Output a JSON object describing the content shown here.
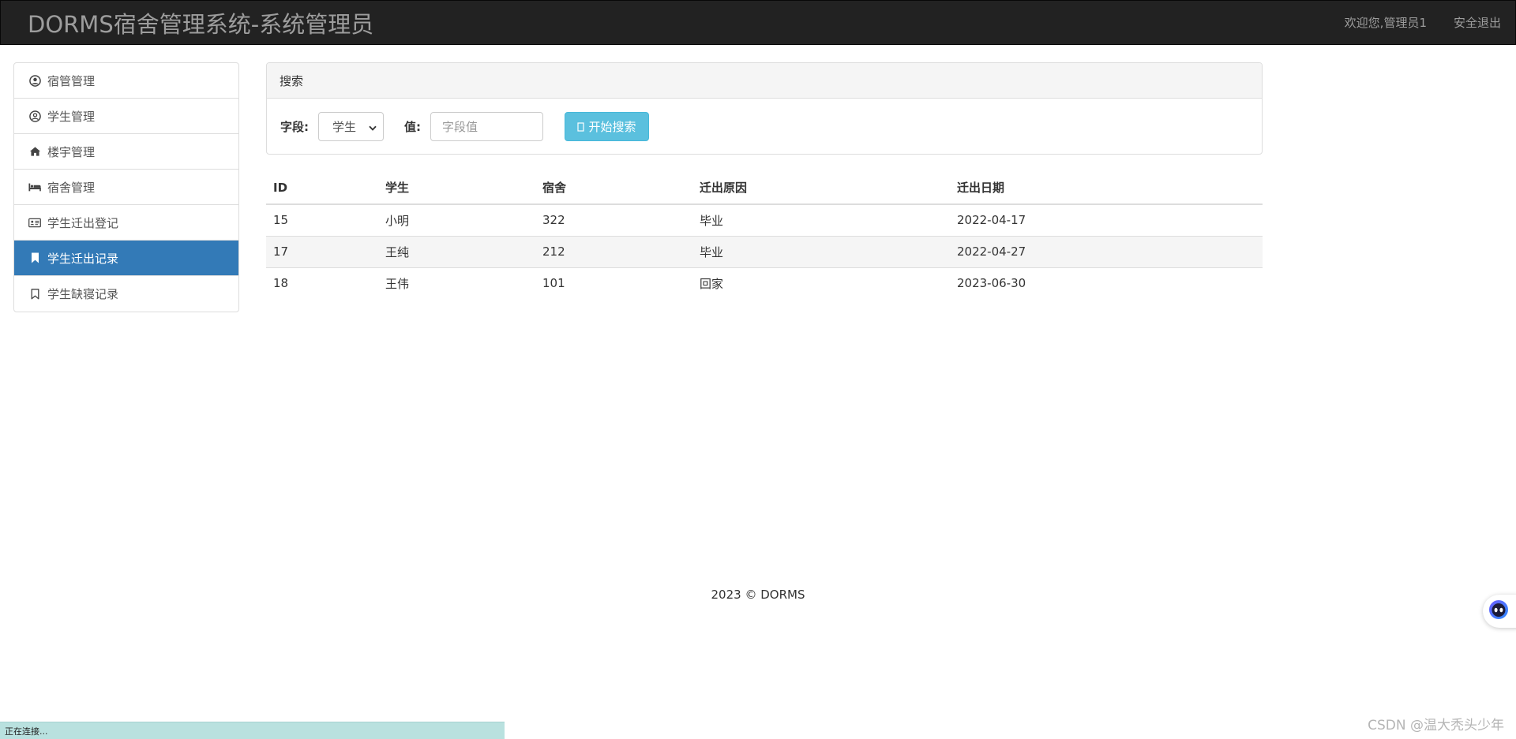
{
  "header": {
    "brand": "DORMS宿舍管理系统-系统管理员",
    "welcome": "欢迎您,管理员1",
    "logout": "安全退出"
  },
  "sidebar": {
    "items": [
      {
        "label": "宿管管理",
        "icon": "user-circle-icon"
      },
      {
        "label": "学生管理",
        "icon": "user-circle-outline-icon"
      },
      {
        "label": "楼宇管理",
        "icon": "home-icon"
      },
      {
        "label": "宿舍管理",
        "icon": "bed-icon"
      },
      {
        "label": "学生迁出登记",
        "icon": "id-card-icon"
      },
      {
        "label": "学生迁出记录",
        "icon": "bookmark-icon",
        "active": true
      },
      {
        "label": "学生缺寝记录",
        "icon": "bookmark-outline-icon"
      }
    ]
  },
  "search": {
    "heading": "搜索",
    "field_label": "字段:",
    "field_value": "学生",
    "value_label": "值:",
    "value_placeholder": "字段值",
    "button_label": "开始搜索"
  },
  "table": {
    "headers": [
      "ID",
      "学生",
      "宿舍",
      "迁出原因",
      "迁出日期"
    ],
    "rows": [
      [
        "15",
        "小明",
        "322",
        "毕业",
        "2022-04-17"
      ],
      [
        "17",
        "王纯",
        "212",
        "毕业",
        "2022-04-27"
      ],
      [
        "18",
        "王伟",
        "101",
        "回家",
        "2023-06-30"
      ]
    ]
  },
  "footer": {
    "text": "2023 © DORMS"
  },
  "status_bar": {
    "text": "正在连接..."
  },
  "watermark": {
    "text": "CSDN @温大秃头少年"
  },
  "colors": {
    "navbar": "#222222",
    "active": "#337ab7",
    "search_button": "#5bc0de",
    "status_bar": "#b9e1df"
  }
}
